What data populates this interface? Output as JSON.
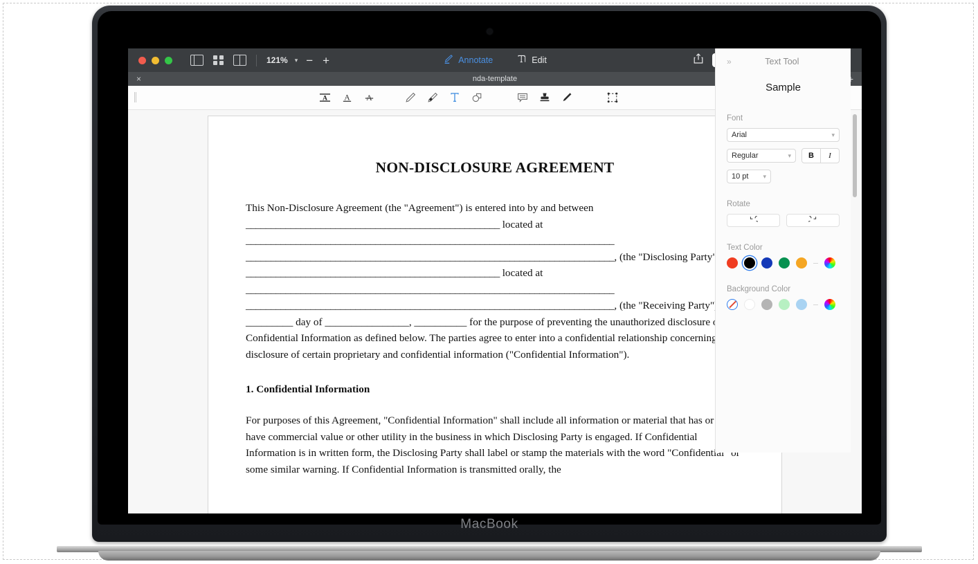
{
  "device": {
    "brand": "MacBook"
  },
  "titlebar": {
    "window_controls": [
      "close",
      "minimize",
      "maximize"
    ],
    "view_icons": [
      "sidebar-toggle",
      "thumbnail-grid",
      "two-page-view"
    ],
    "zoom_level": "121%",
    "zoom_out": "−",
    "zoom_in": "+",
    "modes": [
      {
        "label": "Annotate",
        "icon": "annotate-pen-icon",
        "active": true
      },
      {
        "label": "Edit",
        "icon": "edit-text-icon",
        "active": false
      }
    ],
    "share_icon": "share-icon",
    "search_placeholder": "",
    "search_value": "",
    "search_icon": "search-icon"
  },
  "tabstrip": {
    "close_label": "×",
    "document_name": "nda-template",
    "add_label": "+"
  },
  "annotation_toolbar": {
    "tools": [
      {
        "name": "highlight-text-icon",
        "label": "Highlight",
        "active": false
      },
      {
        "name": "underline-text-icon",
        "label": "Underline",
        "active": false
      },
      {
        "name": "strikethrough-text-icon",
        "label": "Strikethrough",
        "active": false
      },
      {
        "name": "pencil-icon",
        "label": "Draw",
        "active": false
      },
      {
        "name": "eraser-icon",
        "label": "Eraser",
        "active": false
      },
      {
        "name": "text-tool-icon",
        "label": "T",
        "active": true
      },
      {
        "name": "shapes-icon",
        "label": "Shapes",
        "active": false
      },
      {
        "name": "comment-icon",
        "label": "Comment",
        "active": false
      },
      {
        "name": "stamp-icon",
        "label": "Stamp",
        "active": false
      },
      {
        "name": "signature-icon",
        "label": "Signature",
        "active": false
      },
      {
        "name": "crop-select-icon",
        "label": "Select",
        "active": false
      }
    ]
  },
  "document": {
    "title": "NON-DISCLOSURE AGREEMENT",
    "paragraph1_a": "This Non-Disclosure Agreement (the \"Agreement\") is entered into by and between",
    "blank_long": "___________________________________________________",
    "blank_full": "__________________________________________________________________________",
    "located_at": "located at",
    "disclosing_tail": ", (the \"Disclosing Party\") and",
    "receiving_tail": ", (the \"Receiving",
    "party_line": "Party\") on _________ day of ________________, __________ for the purpose of preventing the unauthorized",
    "paragraph1_b": "disclosure of Confidential Information as defined below. The parties agree to enter into a confidential relationship concerning the disclosure of certain proprietary and confidential information (\"Confidential Information\").",
    "section1_heading": "1. Confidential Information",
    "section1_body": "For purposes of this Agreement, \"Confidential Information\" shall include all information or material that has or could have commercial value or other utility in the business in which Disclosing Party is engaged. If Confidential Information is in written form, the Disclosing Party shall label or stamp the materials with the word \"Confidential\" or some similar warning. If Confidential Information is transmitted orally, the"
  },
  "inspector": {
    "collapse_icon": "chevron-right-double-icon",
    "title": "Text Tool",
    "sample_text": "Sample",
    "font_label": "Font",
    "font_family": "Arial",
    "font_style": "Regular",
    "bold_label": "B",
    "italic_label": "I",
    "font_size": "10 pt",
    "rotate_label": "Rotate",
    "rotate_ccw_icon": "rotate-counterclockwise-icon",
    "rotate_cw_icon": "rotate-clockwise-icon",
    "text_color_label": "Text Color",
    "text_colors": [
      {
        "name": "red",
        "hex": "#f03d21",
        "selected": false
      },
      {
        "name": "black",
        "hex": "#000000",
        "selected": true
      },
      {
        "name": "blue",
        "hex": "#1439b8",
        "selected": false
      },
      {
        "name": "green",
        "hex": "#079150",
        "selected": false
      },
      {
        "name": "orange",
        "hex": "#f5a623",
        "selected": false
      },
      {
        "name": "custom",
        "hex": "rainbow",
        "selected": false
      }
    ],
    "background_color_label": "Background Color",
    "background_colors": [
      {
        "name": "none",
        "hex": "none",
        "selected": true
      },
      {
        "name": "white",
        "hex": "#ffffff",
        "selected": false
      },
      {
        "name": "gray",
        "hex": "#b4b4b4",
        "selected": false
      },
      {
        "name": "light-green",
        "hex": "#b7f0c2",
        "selected": false
      },
      {
        "name": "light-blue",
        "hex": "#a9d3f2",
        "selected": false
      },
      {
        "name": "custom",
        "hex": "rainbow",
        "selected": false
      }
    ]
  }
}
